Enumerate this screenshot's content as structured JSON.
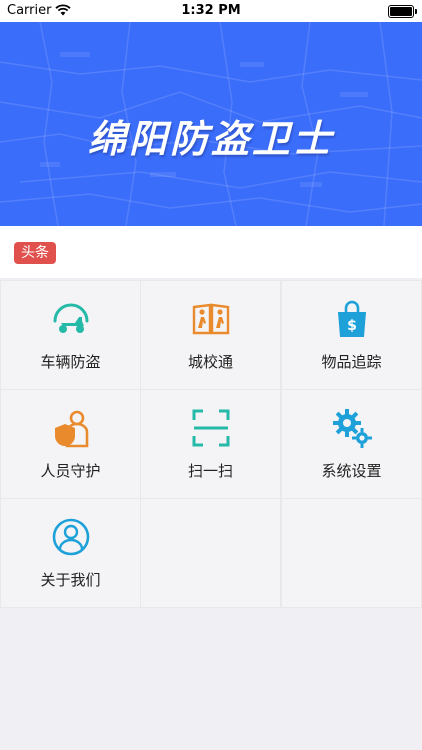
{
  "status_bar": {
    "carrier": "Carrier",
    "time": "1:32 PM"
  },
  "banner": {
    "title": "绵阳防盗卫士"
  },
  "headline": {
    "tag": "头条"
  },
  "menu": {
    "items": [
      {
        "label": "车辆防盗",
        "icon": "scooter-icon",
        "color": "#25b9a8"
      },
      {
        "label": "城校通",
        "icon": "book-kids-icon",
        "color": "#e98a2d"
      },
      {
        "label": "物品追踪",
        "icon": "shopping-bag-dollar-icon",
        "color": "#1da1d8"
      },
      {
        "label": "人员守护",
        "icon": "person-shield-icon",
        "color": "#e98a2d"
      },
      {
        "label": "扫一扫",
        "icon": "scan-icon",
        "color": "#25b9a8"
      },
      {
        "label": "系统设置",
        "icon": "gears-icon",
        "color": "#1da1d8"
      },
      {
        "label": "关于我们",
        "icon": "user-circle-icon",
        "color": "#1da1d8"
      }
    ]
  },
  "colors": {
    "banner_bg": "#3b6dfb",
    "tag_bg": "#e0514e"
  }
}
